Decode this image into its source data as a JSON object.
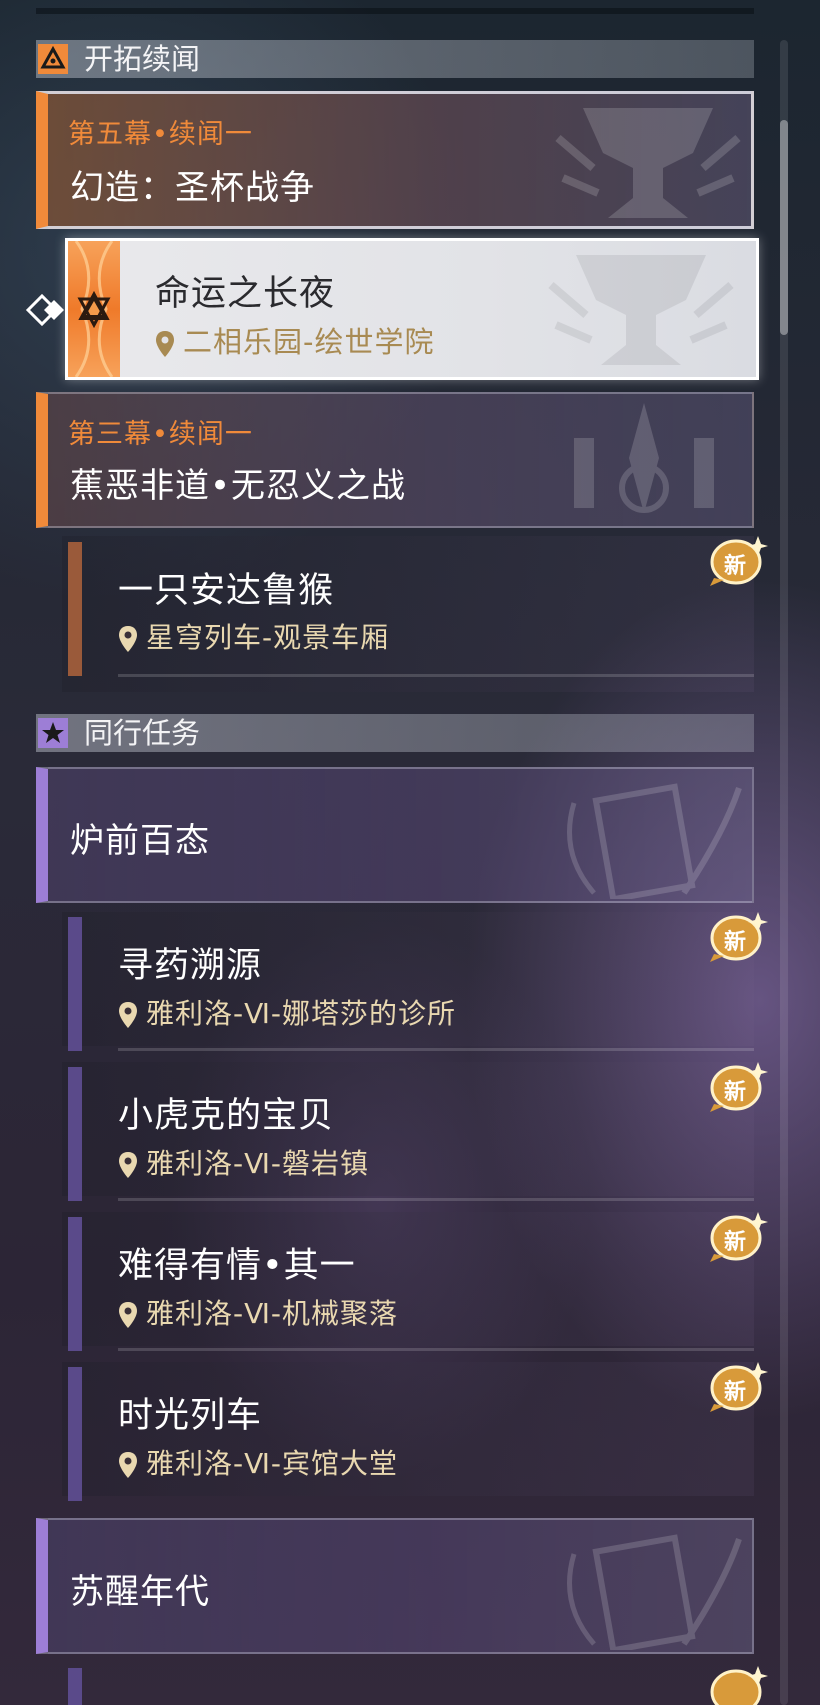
{
  "sections": [
    {
      "title": "开拓续闻",
      "icon": "trailblaze-triangle-icon",
      "color": "#f08a3a"
    },
    {
      "title": "同行任务",
      "icon": "star-icon",
      "color": "#9d7ed6"
    }
  ],
  "trailblaze": {
    "group1": {
      "episode": "第五幕•续闻一",
      "title": "幻造：圣杯战争"
    },
    "selected_quest": {
      "name": "命运之长夜",
      "location": "二相乐园-绘世学院"
    },
    "group2": {
      "episode": "第三幕•续闻一",
      "title": "蕉恶非道•无忍义之战"
    },
    "quests": [
      {
        "name": "一只安达鲁猴",
        "location": "星穹列车-观景车厢",
        "new": "新"
      }
    ]
  },
  "companion": {
    "group1": {
      "title": "炉前百态"
    },
    "quests": [
      {
        "name": "寻药溯源",
        "location": "雅利洛-Ⅵ-娜塔莎的诊所",
        "new": "新"
      },
      {
        "name": "小虎克的宝贝",
        "location": "雅利洛-Ⅵ-磐岩镇",
        "new": "新"
      },
      {
        "name": "难得有情•其一",
        "location": "雅利洛-Ⅵ-机械聚落",
        "new": "新"
      },
      {
        "name": "时光列车",
        "location": "雅利洛-Ⅵ-宾馆大堂",
        "new": "新"
      }
    ],
    "group2": {
      "title": "苏醒年代"
    }
  },
  "colors": {
    "trailblaze_accent": "#f08a3a",
    "companion_accent": "#9d7ed6",
    "location_text": "#e9d8b0",
    "new_badge": "#d89a3a"
  }
}
